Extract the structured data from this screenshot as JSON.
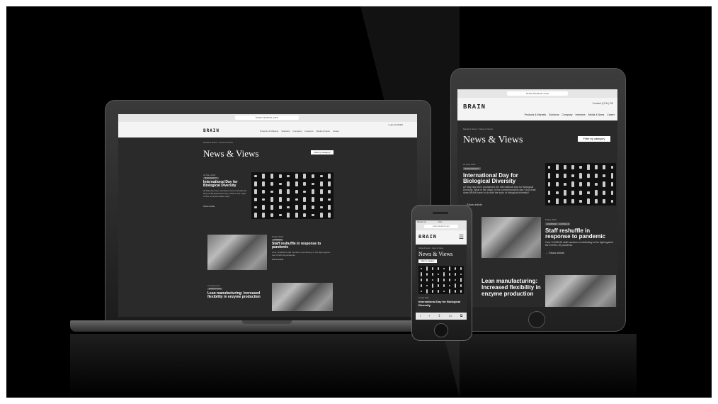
{
  "laptop": {
    "url": "brain-biotech.com",
    "header_links": "Login  Q  DE/EN",
    "logo": "BRAIN",
    "nav": [
      "Products & Markets",
      "Solutions",
      "Company",
      "Investors",
      "Media & News",
      "Career"
    ],
    "breadcrumb": "Media & News  >  News & Views",
    "page_title": "News & Views",
    "filter_label": "Filter by category",
    "articles": [
      {
        "date": "22 May 2020",
        "tag": "BIODIVERSITY",
        "title": "International Day for Biological Diversity",
        "excerpt": "22 May has been proclaimed the International Day for Biological Diversity. What is the origin of this commemoration day?",
        "more": "Show article"
      },
      {
        "date": "8 May 2020",
        "tag": "COMPANY",
        "title": "Staff reshuffle in response to pandemic",
        "excerpt": "Over 10 BRAIN staff members contributing to the fight against the COVID-19 pandemic.",
        "more": "Show article"
      },
      {
        "date": "Coming soon",
        "tag": "PRODUCTION",
        "title": "Lean manufacturing: Increased flexibility in enzyme production",
        "excerpt": "",
        "more": ""
      }
    ]
  },
  "tablet": {
    "url": "brain-biotech.com",
    "logo": "BRAIN",
    "header_links": "Contact  Q  EN | DE",
    "nav": [
      "Products & Markets",
      "Solutions",
      "Company",
      "Investors",
      "Media & News",
      "Career"
    ],
    "breadcrumb": "Media & News  >  News & Views",
    "page_title": "News & Views",
    "filter_label": "Filter by category",
    "articles": [
      {
        "date": "22 May 2020",
        "tag": "BIODIVERSITY",
        "title": "International Day for Biological Diversity",
        "excerpt": "22 May has been proclaimed the International Day for Biological Diversity. What is the origin of this commemoration day? And what does BRAIN have to do with the topic of biological diversity?",
        "more": "→ Show article"
      },
      {
        "date": "8 May 2020",
        "tag": "COMPANY · COVID-19",
        "title": "Staff reshuffle in response to pandemic",
        "excerpt": "Over 10 BRAIN staff members contributing to the fight against the COVID-19 pandemic.",
        "more": "→ Show article"
      },
      {
        "date": "",
        "tag": "",
        "title": "Lean manufacturing: Increased flexibility in enzyme production",
        "excerpt": "",
        "more": ""
      }
    ]
  },
  "phone": {
    "status_carrier": "Telekom.de",
    "status_time": "9:41",
    "url": "brain-biotech.com",
    "logo": "BRAIN",
    "breadcrumb": "Media & News  >  News & Views",
    "page_title": "News & Views",
    "filter_label": "Filter by category",
    "article_date": "22 May 2020",
    "article_title": "International Day for Biological Diversity"
  }
}
